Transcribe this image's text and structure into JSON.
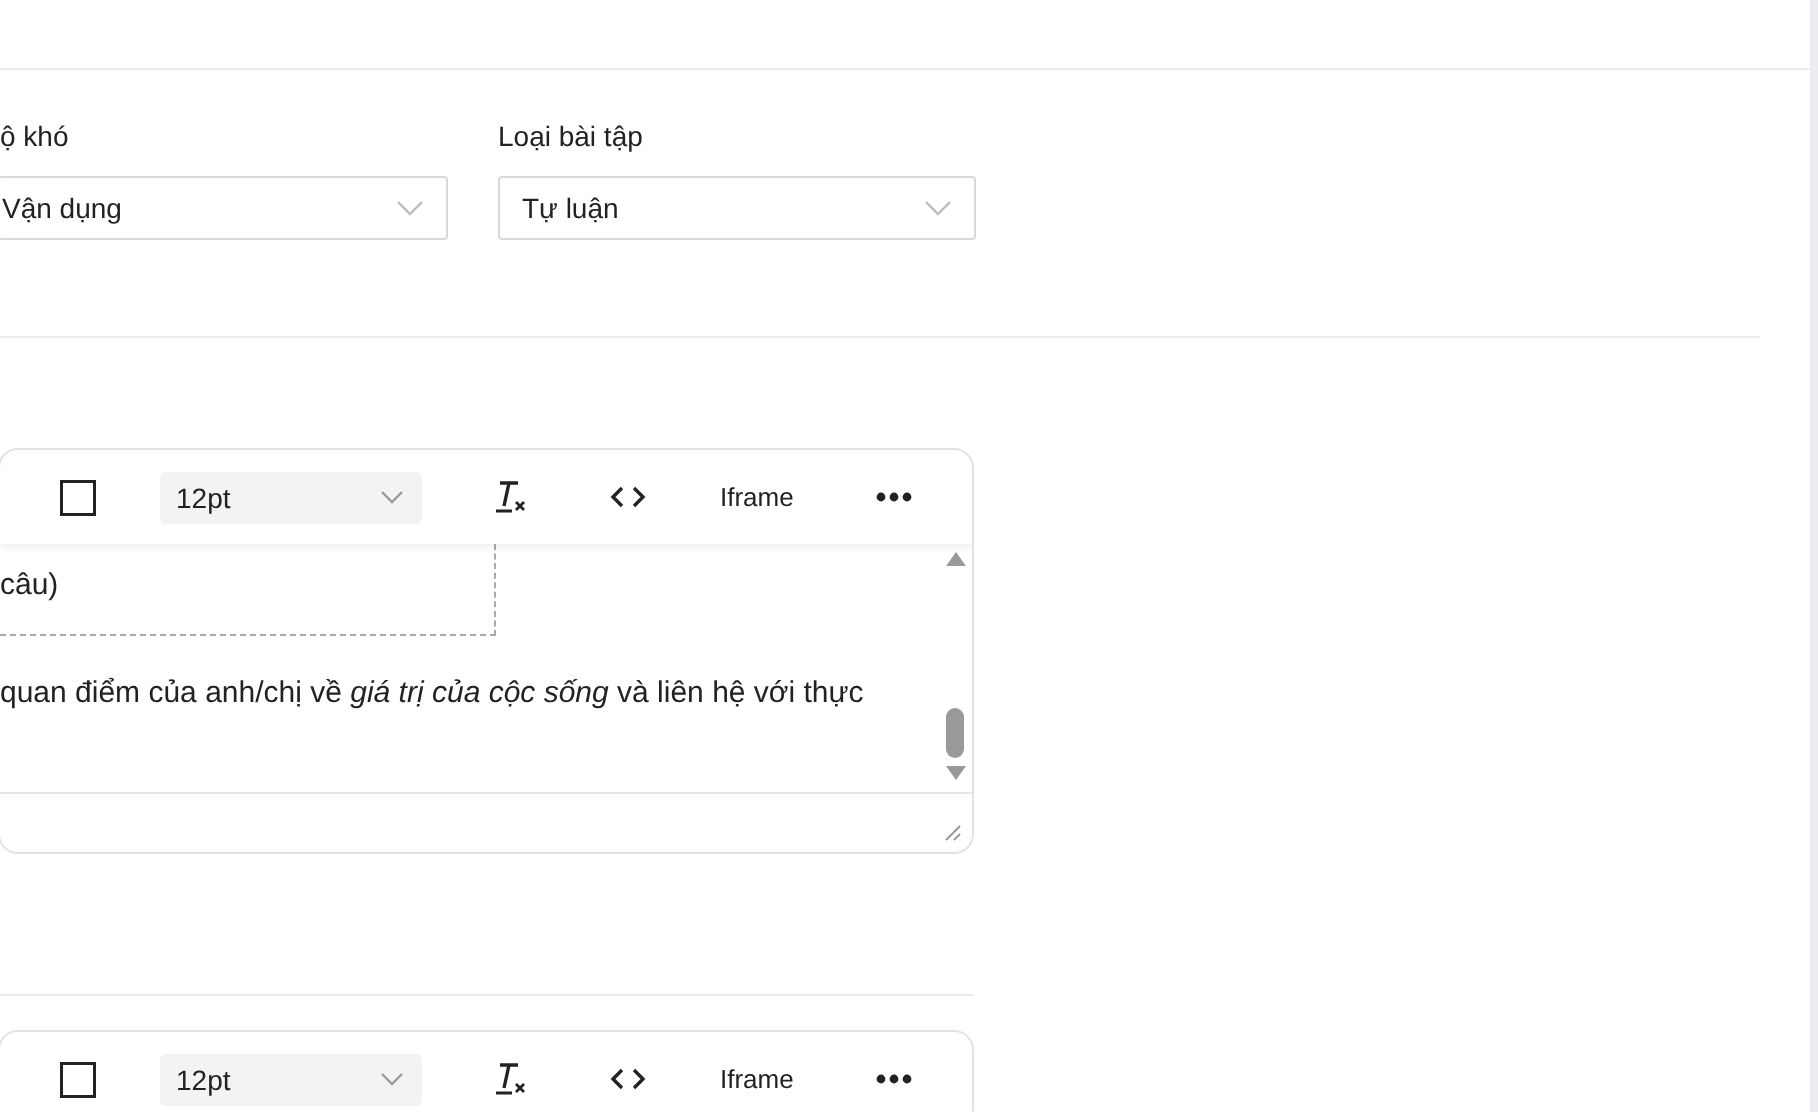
{
  "filters": [
    {
      "label": "ộ khó",
      "value": "Vận dụng"
    },
    {
      "label": "Loại bài tập",
      "value": "Tự luận"
    }
  ],
  "editors": [
    {
      "toolbar": {
        "font_size": "12pt",
        "iframe_button": "Iframe"
      },
      "content": {
        "box_text": "câu)",
        "paragraph": "quan điểm của anh/chị về *giá trị của cộc sống* và liên hệ với thực"
      }
    },
    {
      "toolbar": {
        "font_size": "12pt",
        "iframe_button": "Iframe"
      }
    }
  ]
}
